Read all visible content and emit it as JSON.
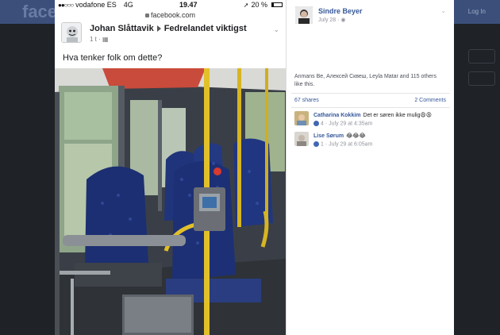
{
  "background": {
    "watermark": "facebook",
    "top_right": "Log In"
  },
  "phone": {
    "status_bar": {
      "carrier": "vodafone ES",
      "network": "4G",
      "time": "19.47",
      "battery": "20 %"
    },
    "url": "facebook.com",
    "post": {
      "author": "Johan Slåttavik",
      "group": "Fedrelandet viktigst",
      "time": "1 t ·",
      "text": "Hva tenker folk om dette?"
    }
  },
  "info_panel": {
    "poster_name": "Sindre Beyer",
    "poster_date": "July 28 ·",
    "likes_text": "Anmans Be, Алексей Сквеш, Leyla Matar and 115 others like this.",
    "shares": "67 shares",
    "comments_count": "2 Comments",
    "comments": [
      {
        "name": "Catharina Kokkim",
        "text": "Det er søren ikke mulig😩😩",
        "likes": "4",
        "time": "· July 29 at 4:35am"
      },
      {
        "name": "Lise Sørum",
        "text": "😂😂😂",
        "likes": "1",
        "time": "· July 29 at 6:05am"
      }
    ]
  }
}
